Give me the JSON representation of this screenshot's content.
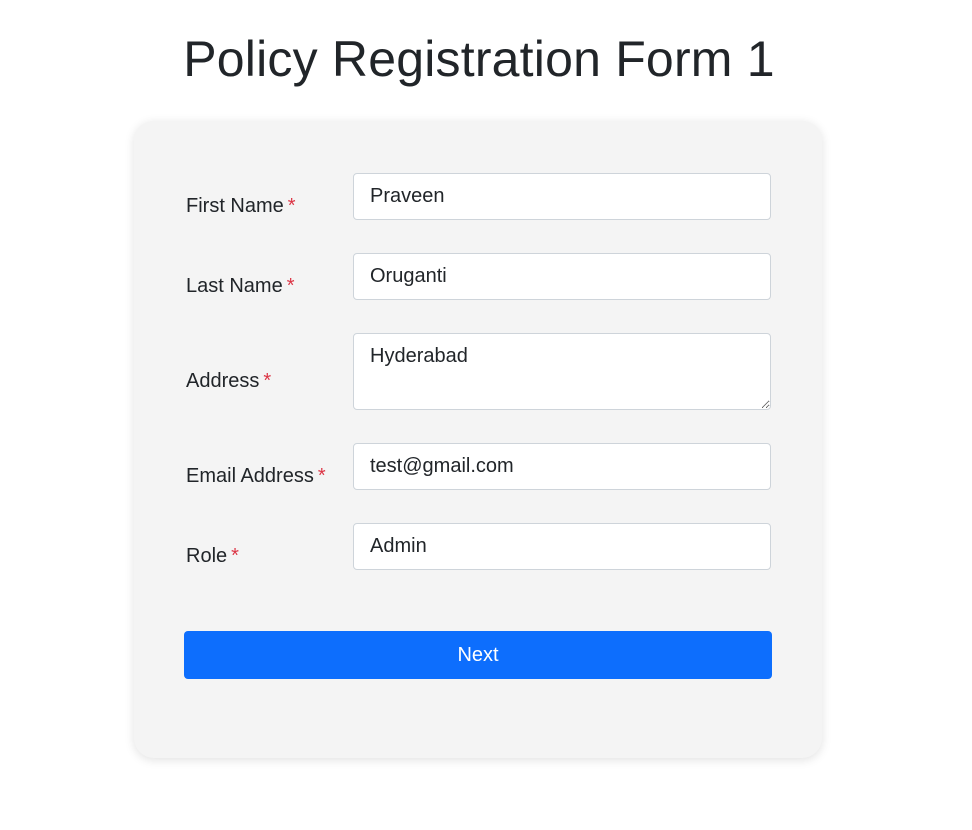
{
  "page": {
    "title": "Policy Registration Form 1"
  },
  "form": {
    "required_marker": "*",
    "fields": {
      "first_name": {
        "label": "First Name",
        "value": "Praveen"
      },
      "last_name": {
        "label": "Last Name",
        "value": "Oruganti"
      },
      "address": {
        "label": "Address",
        "value": "Hyderabad"
      },
      "email": {
        "label": "Email Address",
        "value": "test@gmail.com"
      },
      "role": {
        "label": "Role",
        "value": "Admin"
      }
    },
    "next_label": "Next"
  },
  "colors": {
    "primary_button": "#0d6efd",
    "required_marker": "#dc3545",
    "card_background": "#f4f4f4"
  }
}
